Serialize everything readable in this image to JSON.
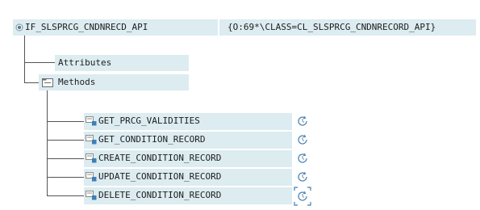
{
  "root": {
    "interface_name": "IF_SLSPRCG_CNDNRECD_API",
    "object_ref": "{O:69*\\CLASS=CL_SLSPRCG_CNDNRECORD_API}",
    "icon": "radio-dot-icon"
  },
  "nodes": {
    "attributes": {
      "label": "Attributes"
    },
    "methods": {
      "label": "Methods",
      "icon": "folder-open-icon"
    }
  },
  "methods": [
    {
      "label": "GET_PRCG_VALIDITIES",
      "icon": "method-icon",
      "action_icon": "clock-icon"
    },
    {
      "label": "GET_CONDITION_RECORD",
      "icon": "method-icon",
      "action_icon": "clock-icon"
    },
    {
      "label": "CREATE_CONDITION_RECORD",
      "icon": "method-icon",
      "action_icon": "clock-icon"
    },
    {
      "label": "UPDATE_CONDITION_RECORD",
      "icon": "method-icon",
      "action_icon": "clock-icon"
    },
    {
      "label": "DELETE_CONDITION_RECORD",
      "icon": "method-icon",
      "action_icon": "clock-icon-focused"
    }
  ],
  "colors": {
    "highlight": "#dcecf1",
    "tree_line": "#555555",
    "icon_blue": "#3f7fb5",
    "icon_gray": "#8a8a8a"
  }
}
